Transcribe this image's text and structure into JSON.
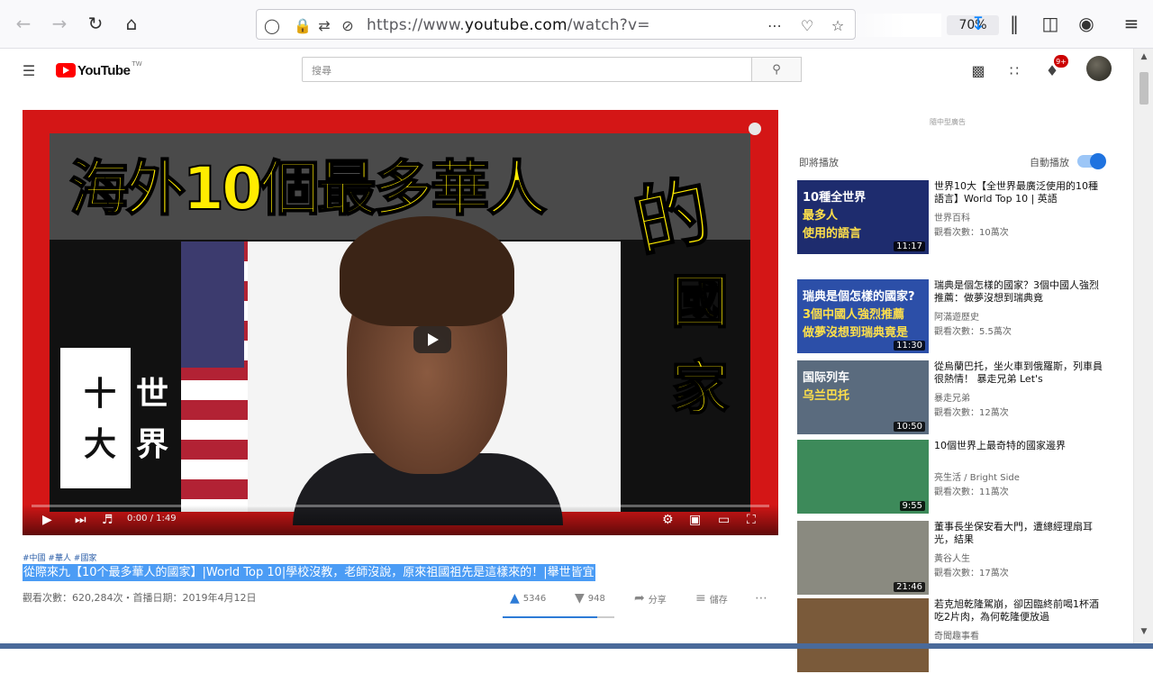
{
  "browser": {
    "url_prefix": "https://www.",
    "url_host": "youtube.com",
    "url_path": "/watch?v=",
    "zoom": "70%"
  },
  "masthead": {
    "logo_text": "YouTube",
    "logo_region": "TW",
    "search_placeholder": "搜尋",
    "notifications_count": "9+"
  },
  "player": {
    "thumbnail_title": "海外10個最多華人",
    "thumbnail_de": "的",
    "thumbnail_side": "國家",
    "badge_left_top": "十",
    "badge_left_bottom": "大",
    "badge_right_top": "世",
    "badge_right_bottom": "界",
    "time": "0:00 / 1:49",
    "progress": 0.0
  },
  "video": {
    "tags": "#中國 #華人 #國家",
    "title": "從際來九【10个最多華人的國家】|World Top 10|學校沒教，老師沒說，原來祖國祖先是這樣來的！|舉世皆宜",
    "views_date": "觀看次數：620,284次・首播日期：2019年4月12日",
    "likes": "5346",
    "dislikes": "948",
    "share": "分享",
    "save": "儲存",
    "like_ratio": 0.85
  },
  "sidebar": {
    "ad_label": "隨中型廣告",
    "up_next": "即將播放",
    "autoplay": "自動播放",
    "cards": [
      {
        "title": "世界10大【全世界最廣泛使用的10種語言】World Top 10 | 英語",
        "channel": "世界百科",
        "views": "觀看次數：10萬次",
        "duration": "11:17",
        "thumb_line1": "10種全世界",
        "thumb_line2": "最多人",
        "thumb_line3": "使用的語言",
        "thumb_color": "#1e2c6e"
      },
      {
        "title": "瑞典是個怎樣的國家？3個中國人強烈推薦：做夢沒想到瑞典竟",
        "channel": "阿滿遊歷史",
        "views": "觀看次數：5.5萬次",
        "duration": "11:30",
        "thumb_line1": "瑞典是個怎樣的國家?",
        "thumb_line2": "3個中國人強烈推薦",
        "thumb_line3": "做夢沒想到瑞典竟是",
        "thumb_color": "#2c4fa8"
      },
      {
        "title": "從烏蘭巴托，坐火車到俄羅斯，列車員很熱情！ 暴走兄弟 Let's",
        "channel": "暴走兄弟",
        "views": "觀看次數：12萬次",
        "duration": "10:50",
        "thumb_line1": "国际列车",
        "thumb_line2": "乌兰巴托",
        "thumb_line3": "",
        "thumb_color": "#5a6b7e"
      },
      {
        "title": "10個世界上最奇特的國家邊界",
        "channel": "亮生活 / Bright Side",
        "views": "觀看次數：11萬次",
        "duration": "9:55",
        "thumb_line1": "",
        "thumb_line2": "",
        "thumb_line3": "",
        "thumb_color": "#3d8a5a"
      },
      {
        "title": "董事長坐保安看大門，遭總經理扇耳光，結果",
        "channel": "黃谷人生",
        "views": "觀看次數：17萬次",
        "duration": "21:46",
        "thumb_line1": "",
        "thumb_line2": "",
        "thumb_line3": "",
        "thumb_color": "#8a8a80"
      },
      {
        "title": "若克旭乾隆駕崩，卻因臨終前喝1杯酒吃2片肉，為何乾隆便放過",
        "channel": "奇聞趣事看",
        "views": "",
        "duration": "",
        "thumb_line1": "",
        "thumb_line2": "",
        "thumb_line3": "",
        "thumb_color": "#7a5a3a"
      }
    ]
  },
  "icons": {
    "back": "back-arrow-icon",
    "forward": "forward-arrow-icon",
    "reload": "reload-icon",
    "home": "home-icon",
    "shield": "shield-icon",
    "lock": "lock-icon",
    "downloads": "download-icon",
    "library": "library-icon",
    "sidebar": "sidebar-icon",
    "account": "account-icon",
    "menu": "hamburger-menu-icon"
  },
  "colors": {
    "youtube_red": "#ff0000",
    "selection_blue": "#4b9cf5",
    "thumbnail_yellow": "#ffec00",
    "like_blue": "#2d7bd6"
  }
}
